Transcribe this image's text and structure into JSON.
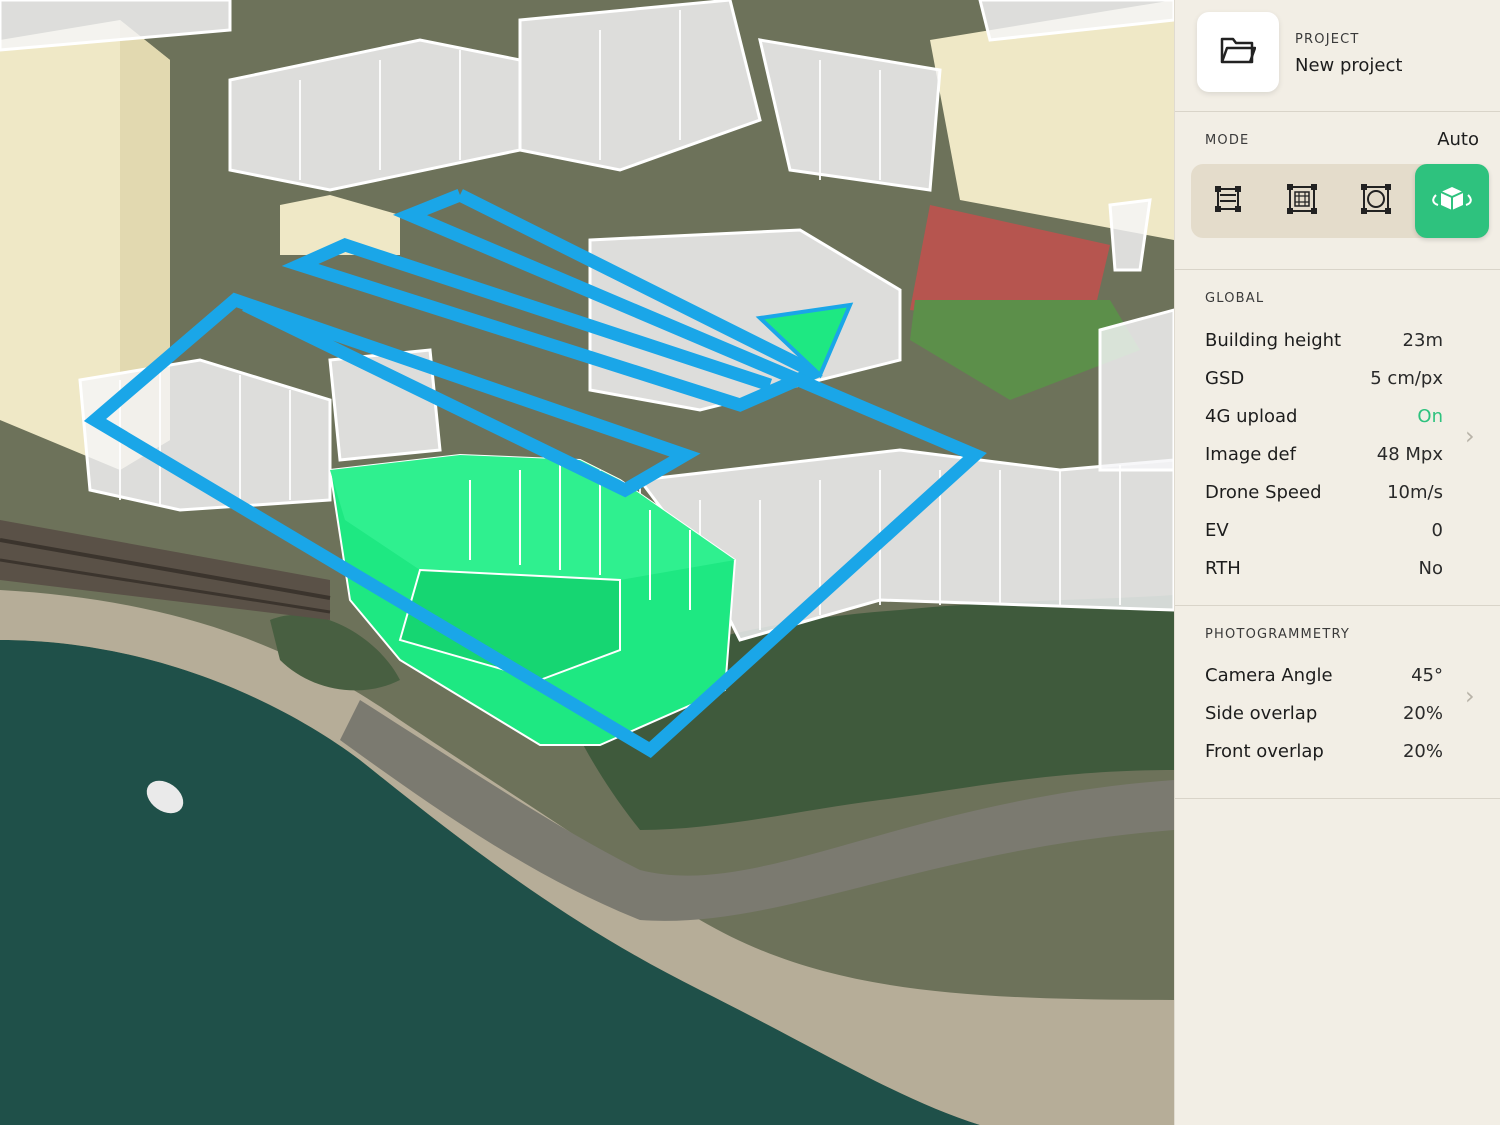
{
  "project": {
    "caption": "PROJECT",
    "name": "New project",
    "icon": "folder-icon"
  },
  "mode": {
    "caption": "MODE",
    "value": "Auto",
    "buttons": [
      {
        "icon": "waypoint-path-icon",
        "active": false
      },
      {
        "icon": "grid-survey-icon",
        "active": false
      },
      {
        "icon": "orbit-survey-icon",
        "active": false
      },
      {
        "icon": "3d-building-icon",
        "active": true
      }
    ]
  },
  "global": {
    "caption": "GLOBAL",
    "rows": [
      {
        "label": "Building height",
        "value": "23m"
      },
      {
        "label": "GSD",
        "value": "5 cm/px"
      },
      {
        "label": "4G upload",
        "value": "On"
      },
      {
        "label": "Image def",
        "value": "48 Mpx"
      },
      {
        "label": "Drone Speed",
        "value": "10m/s"
      },
      {
        "label": "EV",
        "value": "0"
      },
      {
        "label": "RTH",
        "value": "No"
      }
    ]
  },
  "photogrammetry": {
    "caption": "PHOTOGRAMMETRY",
    "rows": [
      {
        "label": "Camera Angle",
        "value": "45°"
      },
      {
        "label": "Side overlap",
        "value": "20%"
      },
      {
        "label": "Front overlap",
        "value": "20%"
      }
    ]
  },
  "colors": {
    "accent": "#2ec27e",
    "flight_path": "#1aa6e8",
    "target_building": "#1ee882",
    "panel_bg": "#f2eee5"
  }
}
